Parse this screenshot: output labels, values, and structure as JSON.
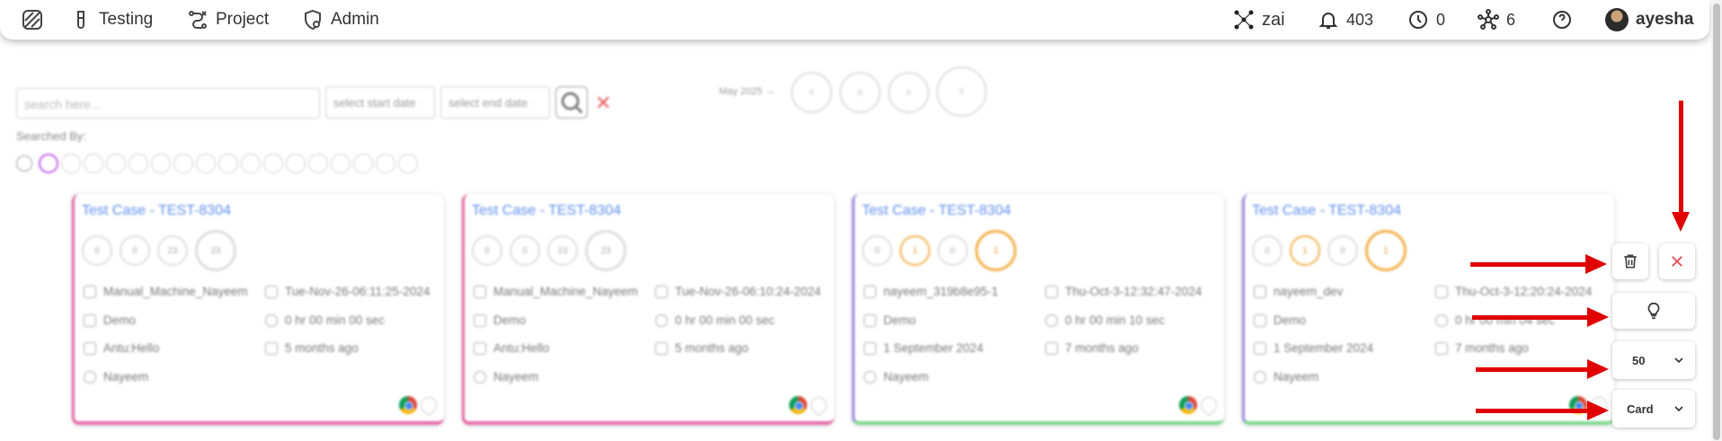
{
  "nav": {
    "items": [
      {
        "label": "Testing",
        "icon": "flask-icon"
      },
      {
        "label": "Project",
        "icon": "project-icon"
      },
      {
        "label": "Admin",
        "icon": "admin-shield-icon"
      }
    ],
    "workspace": "zai",
    "notifications_count": "403",
    "timer_count": "0",
    "network_count": "6",
    "user_name": "ayesha"
  },
  "filters": {
    "search_placeholder": "search here...",
    "start_date_placeholder": "select start date",
    "end_date_placeholder": "select end date",
    "month_label": "May 2025 →",
    "month_circles": [
      "0",
      "0",
      "0",
      "0"
    ],
    "searched_by_label": "Searched By:"
  },
  "cards": [
    {
      "title": "Test Case - TEST-8304",
      "counts": [
        "0",
        "0",
        "23",
        "23"
      ],
      "creator": "Manual_Machine_Nayeem",
      "date": "Tue-Nov-26-06:11:25-2024",
      "environment": "Demo",
      "duration": "0 hr 00 min 00 sec",
      "suite": "Antu:Hello",
      "age": "5 months ago",
      "assignee": "Nayeem",
      "accent": "#e86aa8",
      "bottom": "#e86aa8"
    },
    {
      "title": "Test Case - TEST-8304",
      "counts": [
        "0",
        "0",
        "23",
        "23"
      ],
      "creator": "Manual_Machine_Nayeem",
      "date": "Tue-Nov-26-06:10:24-2024",
      "environment": "Demo",
      "duration": "0 hr 00 min 00 sec",
      "suite": "Antu:Hello",
      "age": "5 months ago",
      "assignee": "Nayeem",
      "accent": "#e86aa8",
      "bottom": "#e86aa8"
    },
    {
      "title": "Test Case - TEST-8304",
      "counts": [
        "0",
        "1",
        "0",
        "1"
      ],
      "creator": "nayeem_319b8e95-1",
      "date": "Thu-Oct-3-12:32:47-2024",
      "environment": "Demo",
      "duration": "0 hr 00 min 10 sec",
      "suite": "1 September 2024",
      "age": "7 months ago",
      "assignee": "Nayeem",
      "accent": "#9b8be0",
      "bottom": "#7bd88f"
    },
    {
      "title": "Test Case - TEST-8304",
      "counts": [
        "0",
        "1",
        "0",
        "1"
      ],
      "creator": "nayeem_dev",
      "date": "Thu-Oct-3-12:20:24-2024",
      "environment": "Demo",
      "duration": "0 hr 00 min 04 sec",
      "suite": "1 September 2024",
      "age": "7 months ago",
      "assignee": "Nayeem",
      "accent": "#9b8be0",
      "bottom": "#7bd88f"
    }
  ],
  "toolbar": {
    "page_size": "50",
    "view_mode": "Card"
  }
}
